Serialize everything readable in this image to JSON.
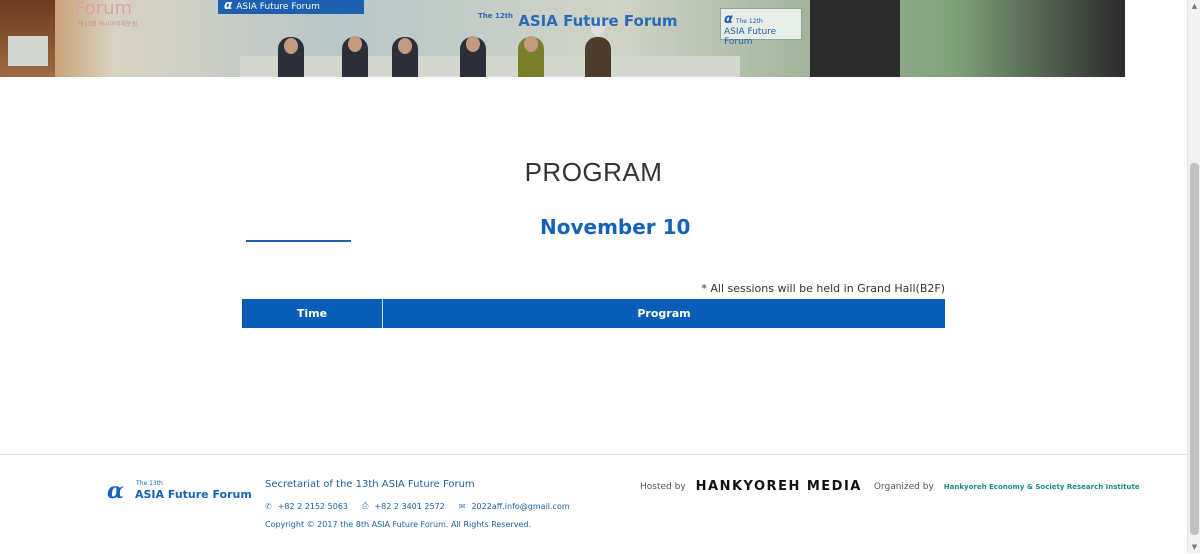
{
  "banner": {
    "forum_word": "Forum",
    "forum_sub": "제13회 아시아미래포럼",
    "sign_left": "ASIA Future Forum",
    "sign_center_small": "The 12th",
    "sign_center": "ASIA Future Forum",
    "sign_right_small": "The 12th",
    "sign_right": "ASIA Future Forum"
  },
  "main": {
    "title": "PROGRAM",
    "day_title": "November 10",
    "note": "* All sessions will be held in Grand Hall(B2F)",
    "table": {
      "headers": [
        "Time",
        "Program"
      ]
    }
  },
  "footer": {
    "logo_small": "The 13th",
    "logo_name": "ASIA Future Forum",
    "secretariat": "Secretariat of the 13th ASIA Future Forum",
    "phone": "+82 2 2152 5063",
    "fax": "+82 2 3401 2572",
    "email": "2022aff.info@gmail.com",
    "copyright": "Copyright © 2017 the 8th ASIA Future Forum. All Rights Reserved.",
    "hosted_label": "Hosted by",
    "host_name": "HANKYOREH MEDIA",
    "organized_label": "Organized by",
    "organizer_highlight": "Hankyoreh",
    "organizer_rest": " Economy & Society Research Institute"
  },
  "icons": {
    "phone": "phone-icon",
    "fax": "printer-icon",
    "email": "mail-icon"
  },
  "colors": {
    "accent": "#1563b8",
    "table_header": "#0a5eb8",
    "footer_text": "#1f5e9e"
  }
}
